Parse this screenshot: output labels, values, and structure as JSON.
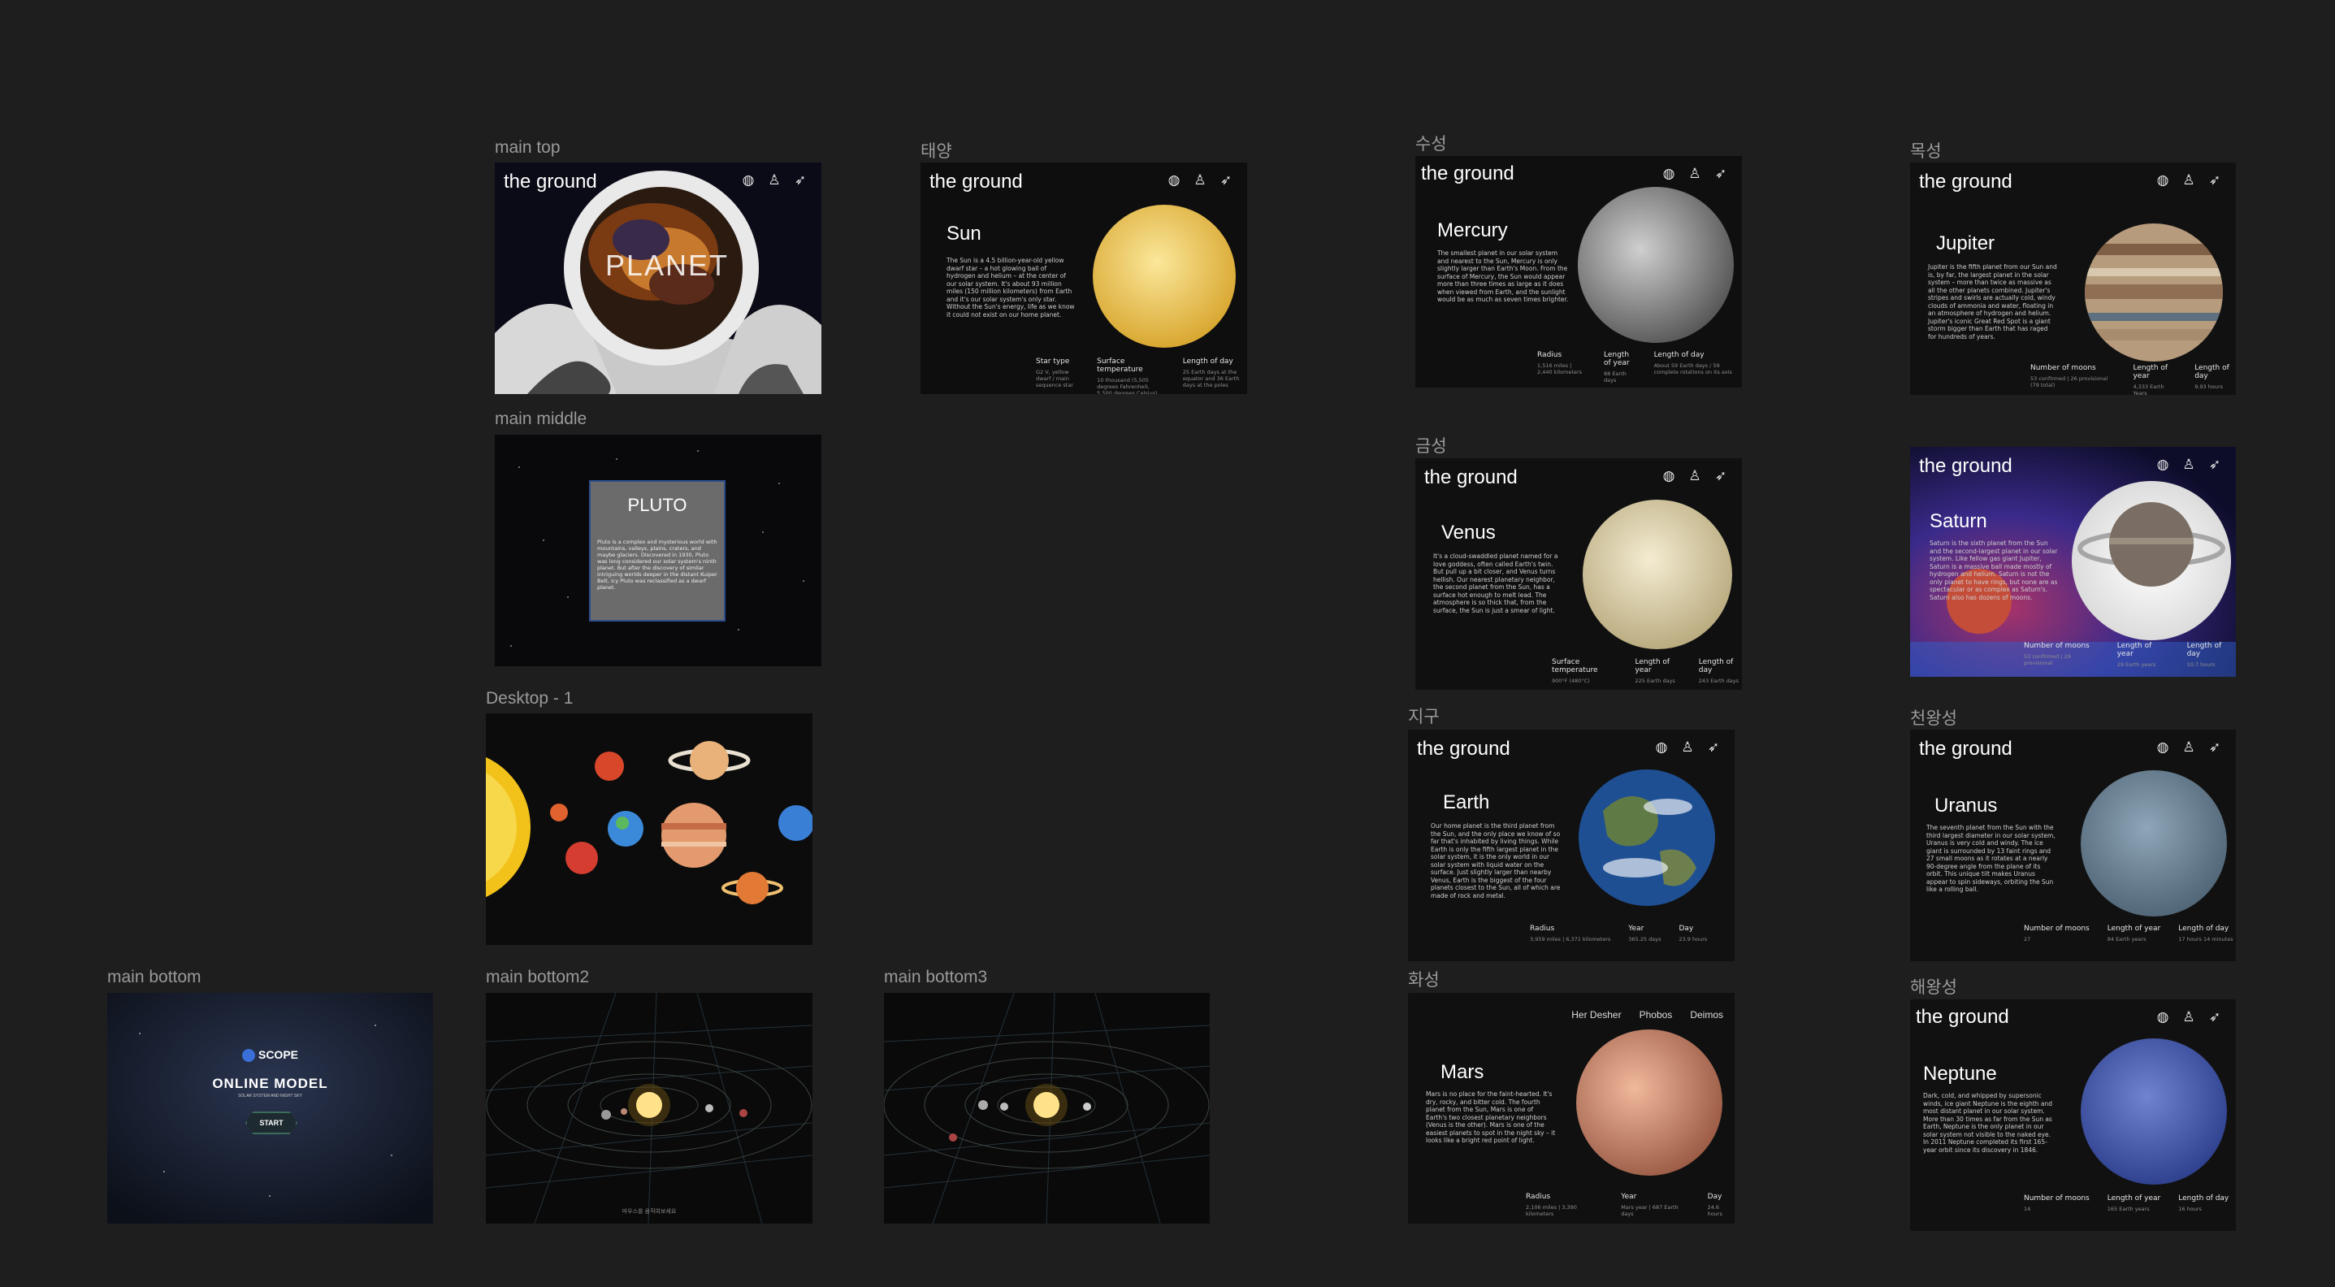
{
  "brand": "the ground",
  "frames": {
    "main_top": {
      "label": "main top",
      "text": "PLANET"
    },
    "main_middle": {
      "label": "main middle",
      "title": "PLUTO",
      "desc": "Pluto is a complex and mysterious world with mountains, valleys, plains, craters, and maybe glaciers. Discovered in 1930, Pluto was long considered our solar system's ninth planet. But after the discovery of similar intriguing worlds deeper in the distant Kuiper Belt, icy Pluto was reclassified as a dwarf planet."
    },
    "desktop1": {
      "label": "Desktop - 1"
    },
    "main_bottom": {
      "label": "main bottom",
      "logo": "SCOPE",
      "logo_sub": "",
      "title": "ONLINE MODEL",
      "subtitle": "SOLAR SYSTEM AND NIGHT SKY",
      "start": "START"
    },
    "main_bottom2": {
      "label": "main bottom2",
      "caption": "마우스를 움직여보세요"
    },
    "main_bottom3": {
      "label": "main bottom3"
    },
    "sun": {
      "label": "태양",
      "title": "Sun",
      "desc": "The Sun is a 4.5 billion-year-old yellow dwarf star – a hot glowing ball of hydrogen and helium – at the center of our solar system. It's about 93 million miles (150 million kilometers) from Earth and it's our solar system's only star. Without the Sun's energy, life as we know it could not exist on our home planet.",
      "stats": [
        {
          "h": "Star type",
          "v": "G2 V, yellow dwarf / main sequence star"
        },
        {
          "h": "Surface temperature",
          "v": "10 thousand (5,505 degrees Fahrenheit, 5,500 degrees Celsius)"
        },
        {
          "h": "Length of day",
          "v": "25 Earth days at the equator and 36 Earth days at the poles"
        }
      ]
    },
    "mercury": {
      "label": "수성",
      "title": "Mercury",
      "desc": "The smallest planet in our solar system and nearest to the Sun, Mercury is only slightly larger than Earth's Moon. From the surface of Mercury, the Sun would appear more than three times as large as it does when viewed from Earth, and the sunlight would be as much as seven times brighter.",
      "stats": [
        {
          "h": "Radius",
          "v": "1,516 miles | 2,440 kilometers"
        },
        {
          "h": "Length of year",
          "v": "88 Earth days"
        },
        {
          "h": "Length of day",
          "v": "About 59 Earth days / 59 complete rotations on its axis"
        }
      ]
    },
    "venus": {
      "label": "금성",
      "title": "Venus",
      "desc": "It's a cloud-swaddled planet named for a love goddess, often called Earth's twin. But pull up a bit closer, and Venus turns hellish. Our nearest planetary neighbor, the second planet from the Sun, has a surface hot enough to melt lead. The atmosphere is so thick that, from the surface, the Sun is just a smear of light.",
      "stats": [
        {
          "h": "Surface temperature",
          "v": "900°F (480°C)"
        },
        {
          "h": "Length of year",
          "v": "225 Earth days"
        },
        {
          "h": "Length of day",
          "v": "243 Earth days"
        }
      ]
    },
    "earth": {
      "label": "지구",
      "title": "Earth",
      "desc": "Our home planet is the third planet from the Sun, and the only place we know of so far that's inhabited by living things. While Earth is only the fifth largest planet in the solar system, it is the only world in our solar system with liquid water on the surface. Just slightly larger than nearby Venus, Earth is the biggest of the four planets closest to the Sun, all of which are made of rock and metal.",
      "stats": [
        {
          "h": "Radius",
          "v": "3,959 miles | 6,371 kilometers"
        },
        {
          "h": "Year",
          "v": "365.25 days"
        },
        {
          "h": "Day",
          "v": "23.9 hours"
        }
      ]
    },
    "mars": {
      "label": "화성",
      "title": "Mars",
      "moons": [
        "Her Desher",
        "Phobos",
        "Deimos"
      ],
      "desc": "Mars is no place for the faint-hearted. It's dry, rocky, and bitter cold. The fourth planet from the Sun, Mars is one of Earth's two closest planetary neighbors (Venus is the other). Mars is one of the easiest planets to spot in the night sky – it looks like a bright red point of light.",
      "stats": [
        {
          "h": "Radius",
          "v": "2,106 miles | 3,390 kilometers"
        },
        {
          "h": "Year",
          "v": "Mars year | 687 Earth days"
        },
        {
          "h": "Day",
          "v": "24.6 hours"
        }
      ]
    },
    "jupiter": {
      "label": "목성",
      "title": "Jupiter",
      "desc": "Jupiter is the fifth planet from our Sun and is, by far, the largest planet in the solar system – more than twice as massive as all the other planets combined. Jupiter's stripes and swirls are actually cold, windy clouds of ammonia and water, floating in an atmosphere of hydrogen and helium. Jupiter's iconic Great Red Spot is a giant storm bigger than Earth that has raged for hundreds of years.",
      "stats": [
        {
          "h": "Number of moons",
          "v": "53 confirmed | 26 provisional (79 total)"
        },
        {
          "h": "Length of year",
          "v": "4,333 Earth Years"
        },
        {
          "h": "Length of day",
          "v": "9.93 hours"
        }
      ]
    },
    "saturn": {
      "label": "",
      "title": "Saturn",
      "desc": "Saturn is the sixth planet from the Sun and the second-largest planet in our solar system. Like fellow gas giant Jupiter, Saturn is a massive ball made mostly of hydrogen and helium. Saturn is not the only planet to have rings, but none are as spectacular or as complex as Saturn's. Saturn also has dozens of moons.",
      "stats": [
        {
          "h": "Number of moons",
          "v": "53 confirmed | 29 provisional"
        },
        {
          "h": "Length of year",
          "v": "29 Earth years"
        },
        {
          "h": "Length of day",
          "v": "10.7 hours"
        }
      ]
    },
    "uranus": {
      "label": "천왕성",
      "title": "Uranus",
      "desc": "The seventh planet from the Sun with the third largest diameter in our solar system, Uranus is very cold and windy. The ice giant is surrounded by 13 faint rings and 27 small moons as it rotates at a nearly 90-degree angle from the plane of its orbit. This unique tilt makes Uranus appear to spin sideways, orbiting the Sun like a rolling ball.",
      "stats": [
        {
          "h": "Number of moons",
          "v": "27"
        },
        {
          "h": "Length of year",
          "v": "84 Earth years"
        },
        {
          "h": "Length of day",
          "v": "17 hours 14 minutes"
        }
      ]
    },
    "neptune": {
      "label": "해왕성",
      "title": "Neptune",
      "desc": "Dark, cold, and whipped by supersonic winds, ice giant Neptune is the eighth and most distant planet in our solar system. More than 30 times as far from the Sun as Earth, Neptune is the only planet in our solar system not visible to the naked eye. In 2011 Neptune completed its first 165-year orbit since its discovery in 1846.",
      "stats": [
        {
          "h": "Number of moons",
          "v": "14"
        },
        {
          "h": "Length of year",
          "v": "165 Earth years"
        },
        {
          "h": "Length of day",
          "v": "16 hours"
        }
      ]
    }
  },
  "icons": [
    "planet-icon",
    "astronaut-icon",
    "rocket-icon"
  ],
  "colors": {
    "canvas": "#1e1e1e",
    "frame_bg": "#0d0d10",
    "label": "#9a9a9a"
  }
}
